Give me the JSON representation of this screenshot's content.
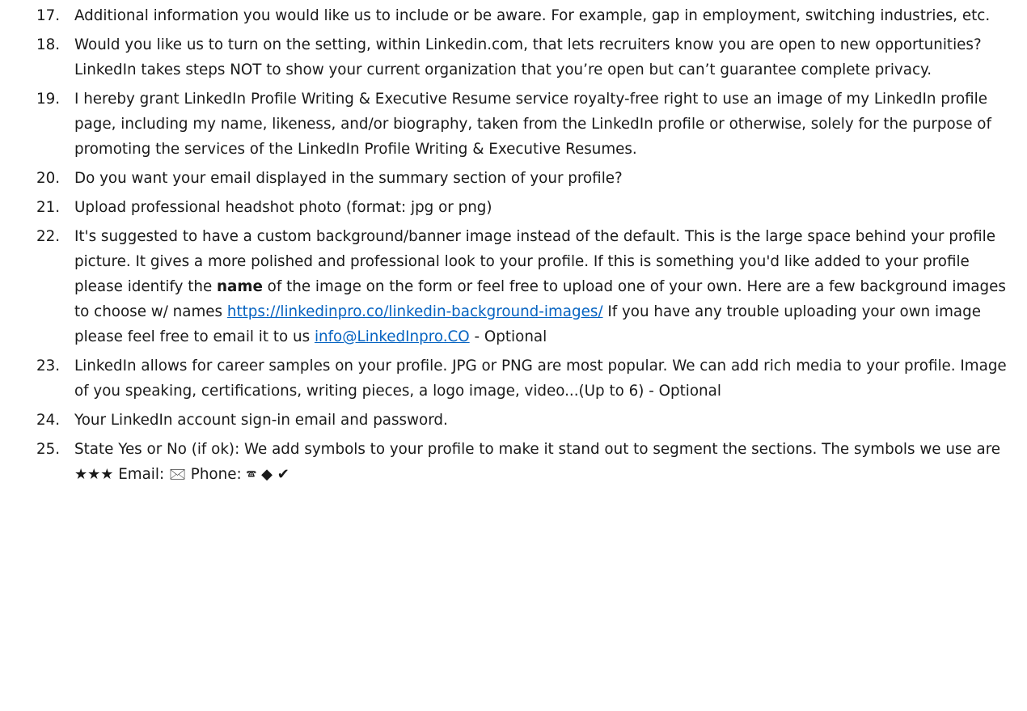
{
  "items": [
    {
      "number": "17.",
      "text": "Additional information you would like us to include or be aware. For example, gap in employment, switching industries, etc."
    },
    {
      "number": "18.",
      "text": "Would you like us to turn on the setting, within Linkedin.com, that lets recruiters know you are open to new opportunities? LinkedIn takes steps NOT to show your current organization that you’re open but can’t guarantee complete privacy."
    },
    {
      "number": "19.",
      "text": "I hereby grant LinkedIn Profile Writing & Executive Resume service royalty-free right to use an image of my LinkedIn profile page, including my name, likeness, and/or biography, taken from the LinkedIn profile or otherwise, solely for the purpose of promoting the services of the LinkedIn Profile Writing & Executive Resumes."
    },
    {
      "number": "20.",
      "text": "Do you want your email displayed in the summary section of your profile?"
    },
    {
      "number": "21.",
      "text": "Upload professional headshot photo (format: jpg or png)"
    },
    {
      "number": "22.",
      "text_a": "It's suggested to have a custom background/banner image instead of the default.  This is the large space behind your profile picture. It gives a more polished and professional look to your profile.  If this is something you'd like added to your profile please identify the ",
      "bold": "name",
      "text_b": " of the image on the form or feel free to upload one of your own.  Here are a few background images to choose w/ names ",
      "link_url": "https://linkedinpro.co/linkedin-background-images/",
      "text_c": "  If you have any trouble uploading your own image please feel free to email it to us ",
      "email": "info@LinkedInpro.CO",
      "text_d": " - Optional"
    },
    {
      "number": "23.",
      "text": "LinkedIn allows for career samples on your profile. JPG or PNG are most popular. We can add rich media to your profile. Image of you speaking, certifications, writing pieces, a logo image, video...(Up to 6) - Optional"
    },
    {
      "number": "24.",
      "text": "Your LinkedIn account sign-in email and password."
    },
    {
      "number": "25.",
      "text_a": "State Yes or No (if ok): We add symbols to your profile to make it stand out to segment the sections. The symbols we use are ",
      "stars": "★★★",
      "email_label": " Email: ",
      "envelope_symbol": "🖂",
      "phone_label": " Phone: ",
      "phone_symbol": "🕿",
      "diamond_symbol": "◆",
      "check_symbol": "✔"
    }
  ]
}
